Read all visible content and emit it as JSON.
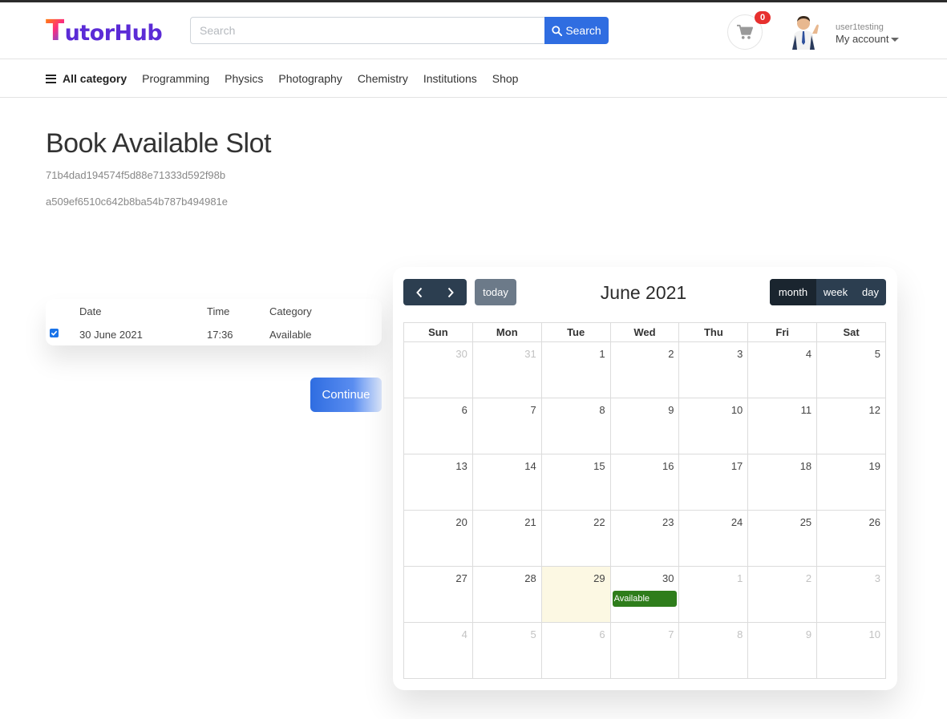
{
  "header": {
    "logo_initial": "T",
    "logo_rest": "utorHub",
    "search_placeholder": "Search",
    "search_button": "Search",
    "cart_count": "0",
    "username": "user1testing",
    "account_label": "My account"
  },
  "nav": {
    "all_category": "All category",
    "items": [
      "Programming",
      "Physics",
      "Photography",
      "Chemistry",
      "Institutions",
      "Shop"
    ]
  },
  "main": {
    "title": "Book Available Slot",
    "hash1": "71b4dad194574f5d88e71333d592f98b",
    "hash2": "a509ef6510c642b8ba54b787b494981e"
  },
  "slots": {
    "columns": [
      "Date",
      "Time",
      "Category"
    ],
    "rows": [
      {
        "checked": true,
        "date": "30 June 2021",
        "time": "17:36",
        "category": "Available"
      }
    ]
  },
  "continue_label": "Continue",
  "calendar": {
    "title": "June 2021",
    "today_label": "today",
    "views": [
      "month",
      "week",
      "day"
    ],
    "active_view": "month",
    "weekdays": [
      "Sun",
      "Mon",
      "Tue",
      "Wed",
      "Thu",
      "Fri",
      "Sat"
    ],
    "weeks": [
      [
        {
          "d": "30",
          "o": true
        },
        {
          "d": "31",
          "o": true
        },
        {
          "d": "1"
        },
        {
          "d": "2"
        },
        {
          "d": "3"
        },
        {
          "d": "4"
        },
        {
          "d": "5"
        }
      ],
      [
        {
          "d": "6"
        },
        {
          "d": "7"
        },
        {
          "d": "8"
        },
        {
          "d": "9"
        },
        {
          "d": "10"
        },
        {
          "d": "11"
        },
        {
          "d": "12"
        }
      ],
      [
        {
          "d": "13"
        },
        {
          "d": "14"
        },
        {
          "d": "15"
        },
        {
          "d": "16"
        },
        {
          "d": "17"
        },
        {
          "d": "18"
        },
        {
          "d": "19"
        }
      ],
      [
        {
          "d": "20"
        },
        {
          "d": "21"
        },
        {
          "d": "22"
        },
        {
          "d": "23"
        },
        {
          "d": "24"
        },
        {
          "d": "25"
        },
        {
          "d": "26"
        }
      ],
      [
        {
          "d": "27"
        },
        {
          "d": "28"
        },
        {
          "d": "29",
          "today": true
        },
        {
          "d": "30",
          "event": "Available"
        },
        {
          "d": "1",
          "o": true
        },
        {
          "d": "2",
          "o": true
        },
        {
          "d": "3",
          "o": true
        }
      ],
      [
        {
          "d": "4",
          "o": true
        },
        {
          "d": "5",
          "o": true
        },
        {
          "d": "6",
          "o": true
        },
        {
          "d": "7",
          "o": true
        },
        {
          "d": "8",
          "o": true
        },
        {
          "d": "9",
          "o": true
        },
        {
          "d": "10",
          "o": true
        }
      ]
    ],
    "event_color": "#2e7d1b",
    "today_color": "#fcf8e3"
  }
}
